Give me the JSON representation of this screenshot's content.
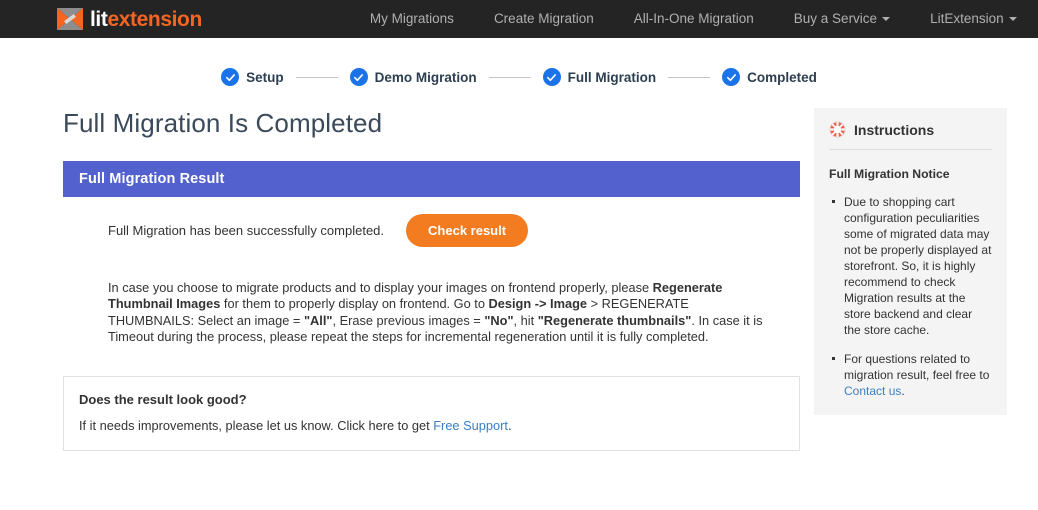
{
  "header": {
    "logo": {
      "icon": "litextension-arrow-logo",
      "text_primary": "lit",
      "text_secondary": "extension",
      "color_primary": "#ffffff",
      "color_secondary": "#f26522"
    },
    "nav": [
      {
        "label": "My Migrations",
        "has_caret": false
      },
      {
        "label": "Create Migration",
        "has_caret": false
      },
      {
        "label": "All-In-One Migration",
        "has_caret": false
      },
      {
        "label": "Buy a Service",
        "has_caret": true
      },
      {
        "label": "LitExtension",
        "has_caret": true
      }
    ]
  },
  "steps": [
    {
      "label": "Setup",
      "state": "completed"
    },
    {
      "label": "Demo Migration",
      "state": "completed"
    },
    {
      "label": "Full Migration",
      "state": "completed"
    },
    {
      "label": "Completed",
      "state": "completed"
    }
  ],
  "main": {
    "page_title": "Full Migration Is Completed",
    "panel": {
      "header": "Full Migration Result",
      "header_color": "#5261cd",
      "result_text": "Full Migration has been successfully completed.",
      "check_button": "Check result",
      "check_button_color": "#f47c20",
      "note_p1_a": "In case you choose to migrate products and to display your images on frontend properly, please ",
      "note_p1_b": "Regenerate Thumbnail Images",
      "note_p1_c": " for them to properly display on frontend. Go to ",
      "note_p1_d": "Design -> Image",
      "note_p1_e": " > REGENERATE THUMBNAILS: Select an image = ",
      "note_p1_f": "\"All\"",
      "note_p1_g": ", Erase previous images = ",
      "note_p1_h": "\"No\"",
      "note_p1_i": ", hit ",
      "note_p1_j": "\"Regenerate thumbnails\"",
      "note_p1_k": ". In case it is Timeout during the process, please repeat the steps for incremental regeneration until it is fully completed."
    },
    "feedback": {
      "title": "Does the result look good?",
      "text_before": "If it needs improvements, please let us know. Click here to get ",
      "link": "Free Support",
      "text_after": "."
    }
  },
  "sidebar": {
    "icon": "lifebuoy-icon",
    "title": "Instructions",
    "subtitle": "Full Migration Notice",
    "items": [
      {
        "text": "Due to shopping cart configuration peculiarities some of migrated data may not be properly displayed at storefront. So, it is highly recommend to check Migration results at the store backend and clear the store cache.",
        "link": null,
        "link_text": null
      },
      {
        "text": "For questions related to migration result, feel free to ",
        "link": "Contact us",
        "link_text": "."
      }
    ]
  }
}
